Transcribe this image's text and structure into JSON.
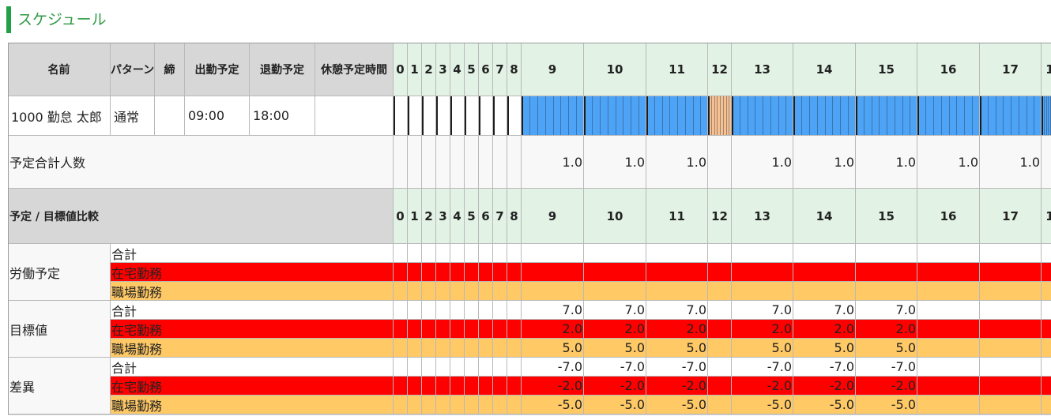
{
  "page_title": "スケジュール",
  "colors": {
    "accent": "#22a046",
    "work_block": "#4da3f5",
    "break_block": "#f8c08f",
    "remote_row": "#ff0000",
    "office_row": "#ffc966"
  },
  "header": {
    "name": "名前",
    "pattern": "パターン",
    "close": "締",
    "start": "出勤予定",
    "end": "退勤予定",
    "break": "休憩予定時間"
  },
  "hours": [
    "0",
    "1",
    "2",
    "3",
    "4",
    "5",
    "6",
    "7",
    "8",
    "9",
    "10",
    "11",
    "12",
    "13",
    "14",
    "15",
    "16",
    "17",
    "1"
  ],
  "employee": {
    "name": "1000 勤怠 太郎",
    "pattern": "通常",
    "close": "",
    "start": "09:00",
    "end": "18:00",
    "break": ""
  },
  "schedule_bar": {
    "work_hours": [
      "9",
      "10",
      "11",
      "13",
      "14",
      "15",
      "16",
      "17",
      "1"
    ],
    "break_hour": "12"
  },
  "planned_total": {
    "label": "予定合計人数",
    "values": [
      "",
      "",
      "",
      "",
      "",
      "",
      "",
      "",
      "",
      "1.0",
      "1.0",
      "1.0",
      "",
      "1.0",
      "1.0",
      "1.0",
      "1.0",
      "1.0",
      ""
    ]
  },
  "comparison": {
    "label": "予定 / 目標値比較",
    "groups": [
      {
        "label": "労働予定",
        "rows": [
          {
            "label": "合計",
            "values": [
              "",
              "",
              "",
              "",
              "",
              "",
              "",
              "",
              "",
              "",
              "",
              "",
              "",
              "",
              "",
              "",
              "",
              "",
              ""
            ]
          },
          {
            "label": "在宅勤務",
            "values": [
              "",
              "",
              "",
              "",
              "",
              "",
              "",
              "",
              "",
              "",
              "",
              "",
              "",
              "",
              "",
              "",
              "",
              "",
              ""
            ]
          },
          {
            "label": "職場勤務",
            "values": [
              "",
              "",
              "",
              "",
              "",
              "",
              "",
              "",
              "",
              "",
              "",
              "",
              "",
              "",
              "",
              "",
              "",
              "",
              ""
            ]
          }
        ]
      },
      {
        "label": "目標値",
        "rows": [
          {
            "label": "合計",
            "values": [
              "",
              "",
              "",
              "",
              "",
              "",
              "",
              "",
              "",
              "7.0",
              "7.0",
              "7.0",
              "",
              "7.0",
              "7.0",
              "7.0",
              "",
              "",
              ""
            ]
          },
          {
            "label": "在宅勤務",
            "values": [
              "",
              "",
              "",
              "",
              "",
              "",
              "",
              "",
              "",
              "2.0",
              "2.0",
              "2.0",
              "",
              "2.0",
              "2.0",
              "2.0",
              "",
              "",
              ""
            ]
          },
          {
            "label": "職場勤務",
            "values": [
              "",
              "",
              "",
              "",
              "",
              "",
              "",
              "",
              "",
              "5.0",
              "5.0",
              "5.0",
              "",
              "5.0",
              "5.0",
              "5.0",
              "",
              "",
              ""
            ]
          }
        ]
      },
      {
        "label": "差異",
        "rows": [
          {
            "label": "合計",
            "values": [
              "",
              "",
              "",
              "",
              "",
              "",
              "",
              "",
              "",
              "-7.0",
              "-7.0",
              "-7.0",
              "",
              "-7.0",
              "-7.0",
              "-7.0",
              "",
              "",
              ""
            ]
          },
          {
            "label": "在宅勤務",
            "values": [
              "",
              "",
              "",
              "",
              "",
              "",
              "",
              "",
              "",
              "-2.0",
              "-2.0",
              "-2.0",
              "",
              "-2.0",
              "-2.0",
              "-2.0",
              "",
              "",
              ""
            ]
          },
          {
            "label": "職場勤務",
            "values": [
              "",
              "",
              "",
              "",
              "",
              "",
              "",
              "",
              "",
              "-5.0",
              "-5.0",
              "-5.0",
              "",
              "-5.0",
              "-5.0",
              "-5.0",
              "",
              "",
              ""
            ]
          }
        ]
      }
    ]
  }
}
